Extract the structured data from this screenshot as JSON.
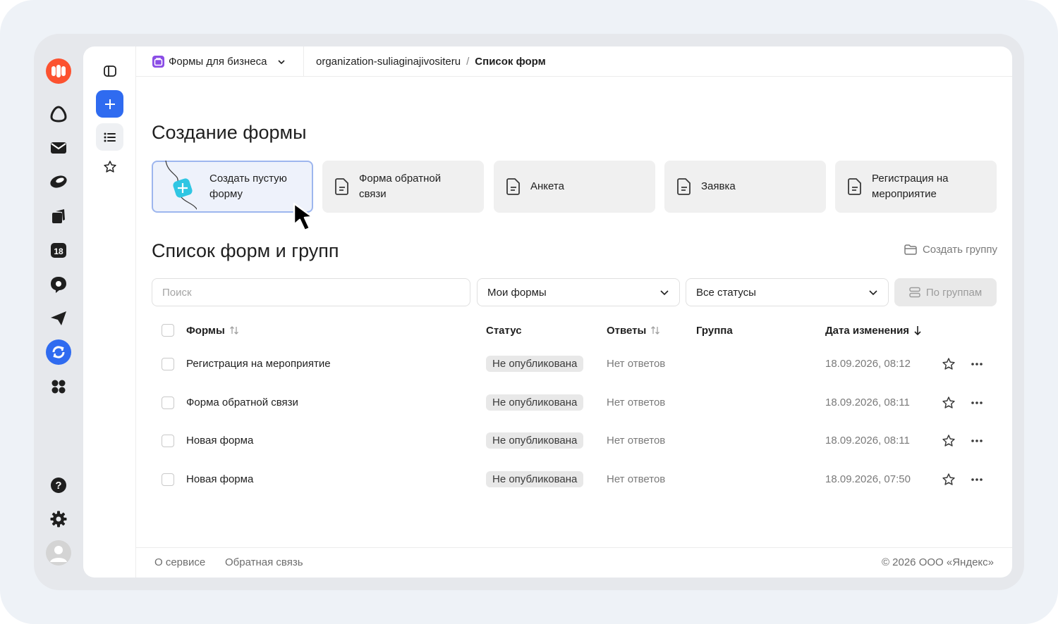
{
  "header": {
    "service_name": "Формы для бизнеса",
    "breadcrumb_org": "organization-suliaginajivositeru",
    "breadcrumb_sep": "/",
    "breadcrumb_current": "Список форм"
  },
  "rail": {
    "icons": [
      "yandex-logo-icon",
      "alice-icon",
      "mail-icon",
      "disk-icon",
      "docs-icon",
      "calendar-icon",
      "messenger-icon",
      "telemost-icon",
      "forms-icon",
      "services-grid-icon",
      "help-icon",
      "settings-icon",
      "avatar"
    ],
    "calendar_day": "18"
  },
  "create": {
    "title": "Создание формы",
    "tiles": [
      {
        "label": "Создать пустую форму"
      },
      {
        "label": "Форма обратной связи"
      },
      {
        "label": "Анкета"
      },
      {
        "label": "Заявка"
      },
      {
        "label": "Регистрация на мероприятие"
      }
    ]
  },
  "list": {
    "title": "Список форм и групп",
    "create_group": "Создать группу",
    "search_placeholder": "Поиск",
    "filter_owner": "Мои формы",
    "filter_status": "Все статусы",
    "group_button": "По группам",
    "columns": {
      "forms": "Формы",
      "status": "Статус",
      "answers": "Ответы",
      "group": "Группа",
      "modified": "Дата изменения"
    },
    "rows": [
      {
        "name": "Регистрация на мероприятие",
        "status": "Не опубликована",
        "answers": "Нет ответов",
        "group": "",
        "modified": "18.09.2026, 08:12"
      },
      {
        "name": "Форма обратной связи",
        "status": "Не опубликована",
        "answers": "Нет ответов",
        "group": "",
        "modified": "18.09.2026, 08:11"
      },
      {
        "name": "Новая форма",
        "status": "Не опубликована",
        "answers": "Нет ответов",
        "group": "",
        "modified": "18.09.2026, 08:11"
      },
      {
        "name": "Новая форма",
        "status": "Не опубликована",
        "answers": "Нет ответов",
        "group": "",
        "modified": "18.09.2026, 07:50"
      }
    ]
  },
  "footer": {
    "about": "О сервисе",
    "feedback": "Обратная связь",
    "copyright": "© 2026 ООО «Яндекс»"
  },
  "colors": {
    "accent": "#2f6bf0",
    "brand_orange": "#fc5230",
    "forms_purple": "#8a4de6"
  }
}
